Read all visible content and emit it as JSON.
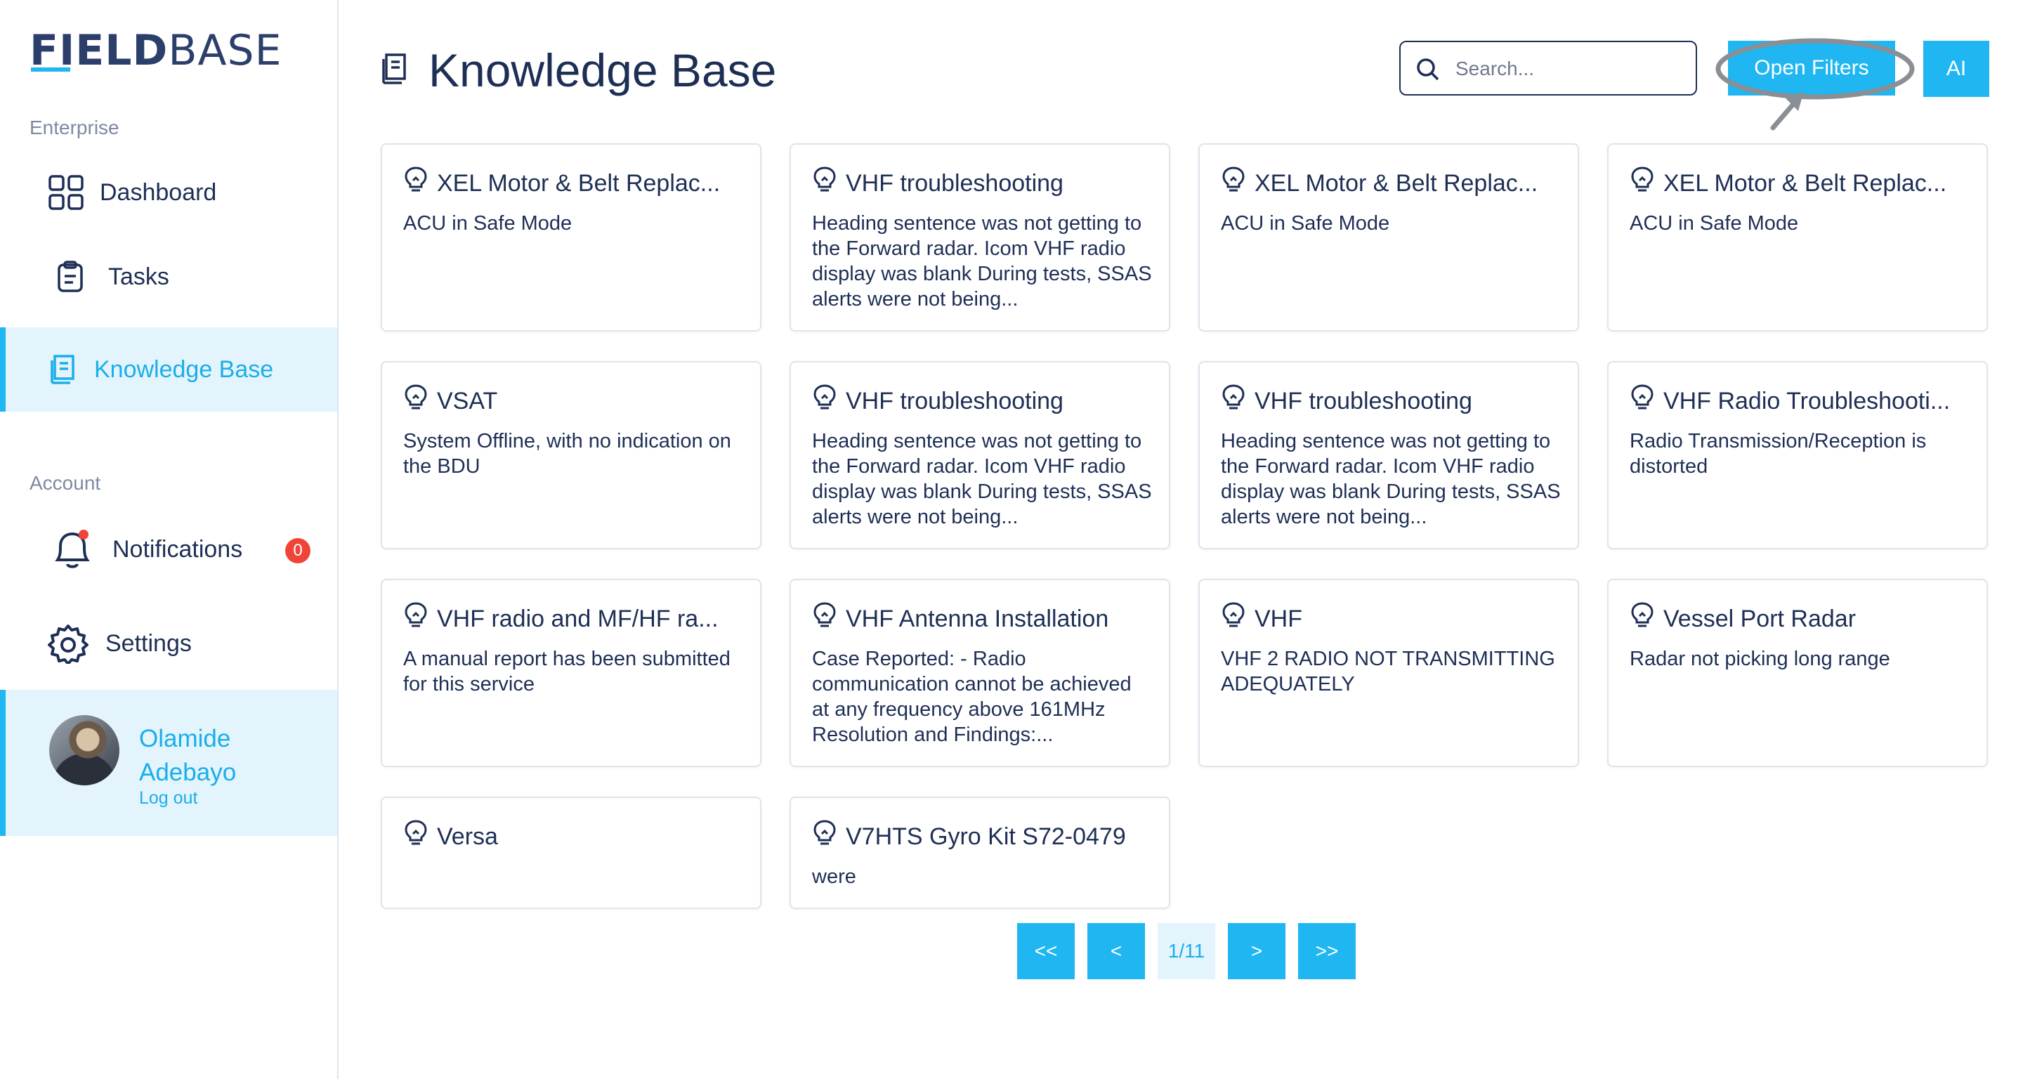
{
  "app": {
    "logo_part1": "FIELD",
    "logo_part2": "BASE"
  },
  "sidebar": {
    "section_enterprise": "Enterprise",
    "section_account": "Account",
    "items": [
      {
        "label": "Dashboard",
        "icon": "grid-icon"
      },
      {
        "label": "Tasks",
        "icon": "clipboard-icon"
      },
      {
        "label": "Knowledge Base",
        "icon": "book-icon",
        "active": true
      },
      {
        "label": "Notifications",
        "icon": "bell-icon",
        "badge": "0"
      },
      {
        "label": "Settings",
        "icon": "gear-icon"
      }
    ],
    "profile": {
      "name": "Olamide Adebayo",
      "logout": "Log out"
    }
  },
  "header": {
    "title": "Knowledge Base",
    "search_placeholder": "Search...",
    "filters_label": "Open Filters",
    "ai_label": "AI"
  },
  "cards": [
    {
      "title": "XEL Motor & Belt Replac...",
      "desc": "ACU in Safe Mode"
    },
    {
      "title": "VHF troubleshooting",
      "desc": "Heading sentence was not getting to the Forward radar. Icom VHF radio display was blank During tests, SSAS alerts were not being..."
    },
    {
      "title": "XEL Motor & Belt Replac...",
      "desc": "ACU in Safe Mode"
    },
    {
      "title": "XEL Motor & Belt Replac...",
      "desc": "ACU in Safe Mode"
    },
    {
      "title": "VSAT",
      "desc": "System Offline, with no indication on the BDU"
    },
    {
      "title": "VHF troubleshooting",
      "desc": "Heading sentence was not getting to the Forward radar. Icom VHF radio display was blank During tests, SSAS alerts were not being..."
    },
    {
      "title": "VHF troubleshooting",
      "desc": "Heading sentence was not getting to the Forward radar. Icom VHF radio display was blank During tests, SSAS alerts were not being..."
    },
    {
      "title": "VHF Radio Troubleshooti...",
      "desc": "Radio Transmission/Reception is distorted"
    },
    {
      "title": "VHF radio and MF/HF ra...",
      "desc": "A manual report has been submitted for this service"
    },
    {
      "title": "VHF Antenna Installation",
      "desc": "Case Reported: - Radio communication cannot be achieved at any frequency above 161MHz Resolution and Findings:..."
    },
    {
      "title": "VHF",
      "desc": "VHF 2 RADIO NOT TRANSMITTING ADEQUATELY"
    },
    {
      "title": "Vessel Port Radar",
      "desc": "Radar not picking long range"
    },
    {
      "title": "Versa",
      "desc": ""
    },
    {
      "title": "V7HTS Gyro Kit S72-0479",
      "desc": "were"
    }
  ],
  "pagination": {
    "first": "<<",
    "prev": "<",
    "indicator": "1/11",
    "next": ">",
    "last": ">>"
  },
  "colors": {
    "accent": "#1fb6f1",
    "text": "#1e2f55",
    "active_bg": "#e3f4fd",
    "badge": "#f04438"
  }
}
